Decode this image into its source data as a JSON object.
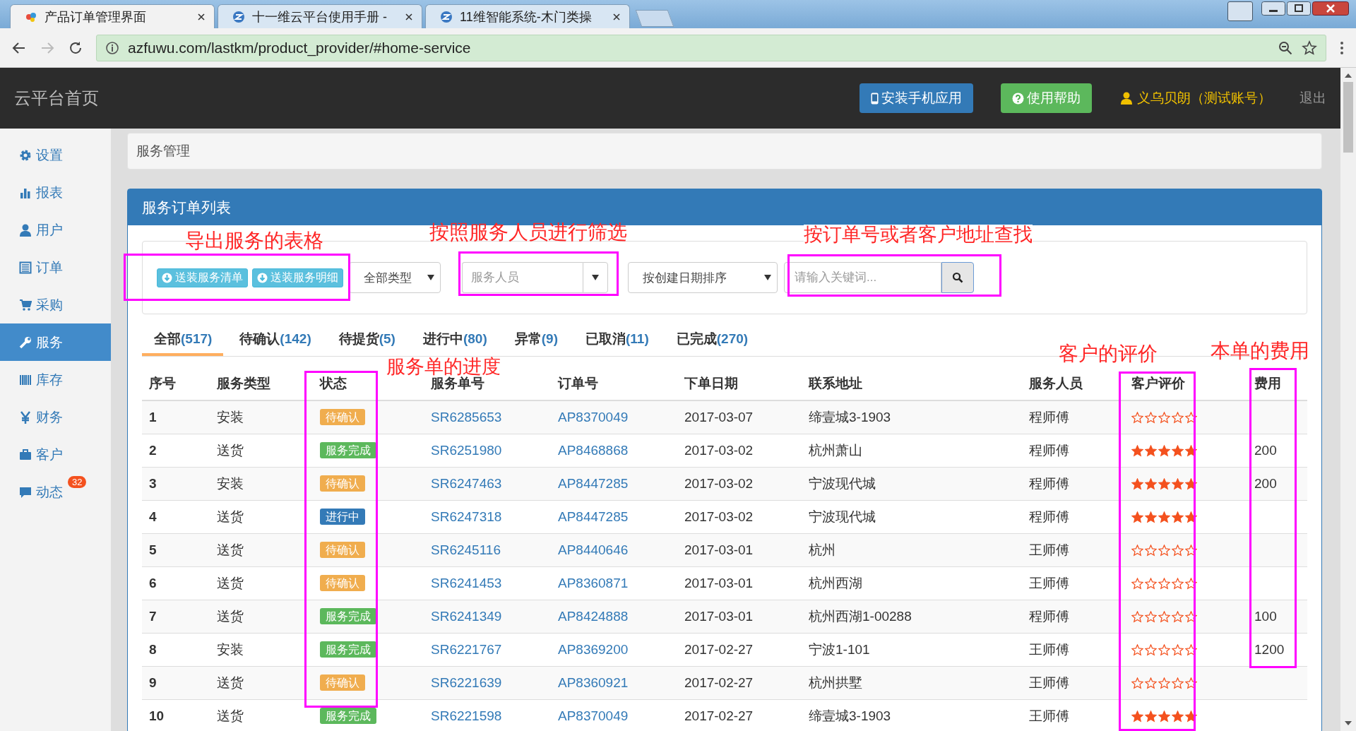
{
  "browser": {
    "tabs": [
      {
        "title": "产品订单管理界面",
        "selected": true
      },
      {
        "title": "十一维云平台使用手册 -",
        "selected": false
      },
      {
        "title": "11维智能系统-木门类操",
        "selected": false
      }
    ],
    "url": "azfuwu.com/lastkm/product_provider/#home-service"
  },
  "header": {
    "brand": "云平台首页",
    "install_button": "安装手机应用",
    "help_button": "使用帮助",
    "user": "义乌贝朗（测试账号）",
    "logout": "退出"
  },
  "sidebar": {
    "items": [
      {
        "label": "设置",
        "selected": false
      },
      {
        "label": "报表",
        "selected": false
      },
      {
        "label": "用户",
        "selected": false
      },
      {
        "label": "订单",
        "selected": false
      },
      {
        "label": "采购",
        "selected": false
      },
      {
        "label": "服务",
        "selected": true
      },
      {
        "label": "库存",
        "selected": false
      },
      {
        "label": "财务",
        "selected": false
      },
      {
        "label": "客户",
        "selected": false
      },
      {
        "label": "动态",
        "selected": false,
        "badge": "32"
      }
    ]
  },
  "breadcrumb": "服务管理",
  "panel": {
    "title": "服务订单列表",
    "export_buttons": [
      "送装服务清单",
      "送装服务明细"
    ],
    "type_select": "全部类型",
    "staff_select": {
      "placeholder": "服务人员"
    },
    "sort_select": "按创建日期排序",
    "search": {
      "placeholder": "请输入关键词..."
    },
    "tabs": [
      {
        "label": "全部",
        "count": "(517)",
        "selected": true
      },
      {
        "label": "待确认",
        "count": "(142)",
        "selected": false
      },
      {
        "label": "待提货",
        "count": "(5)",
        "selected": false
      },
      {
        "label": "进行中",
        "count": "(80)",
        "selected": false
      },
      {
        "label": "异常",
        "count": "(9)",
        "selected": false
      },
      {
        "label": "已取消",
        "count": "(11)",
        "selected": false
      },
      {
        "label": "已完成",
        "count": "(270)",
        "selected": false
      }
    ],
    "table": {
      "columns": [
        "序号",
        "服务类型",
        "状态",
        "服务单号",
        "订单号",
        "下单日期",
        "联系地址",
        "服务人员",
        "客户评价",
        "费用"
      ],
      "rows": [
        {
          "no": "1",
          "type": "安装",
          "status": {
            "text": "待确认",
            "kind": "pending"
          },
          "service_no": "SR6285653",
          "order_no": "AP8370049",
          "date": "2017-03-07",
          "address": "缔壹城3-1903",
          "staff": "程师傅",
          "stars": 0
        },
        {
          "no": "2",
          "type": "送货",
          "status": {
            "text": "服务完成",
            "kind": "done"
          },
          "service_no": "SR6251980",
          "order_no": "AP8468868",
          "date": "2017-03-02",
          "address": "杭州萧山",
          "staff": "程师傅",
          "stars": 5,
          "fee": "200"
        },
        {
          "no": "3",
          "type": "安装",
          "status": {
            "text": "待确认",
            "kind": "pending"
          },
          "service_no": "SR6247463",
          "order_no": "AP8447285",
          "date": "2017-03-02",
          "address": "宁波现代城",
          "staff": "程师傅",
          "stars": 5,
          "fee": "200"
        },
        {
          "no": "4",
          "type": "送货",
          "status": {
            "text": "进行中",
            "kind": "progress"
          },
          "service_no": "SR6247318",
          "order_no": "AP8447285",
          "date": "2017-03-02",
          "address": "宁波现代城",
          "staff": "程师傅",
          "stars": 5
        },
        {
          "no": "5",
          "type": "送货",
          "status": {
            "text": "待确认",
            "kind": "pending"
          },
          "service_no": "SR6245116",
          "order_no": "AP8440646",
          "date": "2017-03-01",
          "address": "杭州",
          "staff": "王师傅",
          "stars": 0
        },
        {
          "no": "6",
          "type": "送货",
          "status": {
            "text": "待确认",
            "kind": "pending"
          },
          "service_no": "SR6241453",
          "order_no": "AP8360871",
          "date": "2017-03-01",
          "address": "杭州西湖",
          "staff": "王师傅",
          "stars": 0
        },
        {
          "no": "7",
          "type": "送货",
          "status": {
            "text": "服务完成",
            "kind": "done"
          },
          "service_no": "SR6241349",
          "order_no": "AP8424888",
          "date": "2017-03-01",
          "address": "杭州西湖1-00288",
          "staff": "程师傅",
          "stars": 0,
          "fee": "100"
        },
        {
          "no": "8",
          "type": "安装",
          "status": {
            "text": "服务完成",
            "kind": "done"
          },
          "service_no": "SR6221767",
          "order_no": "AP8369200",
          "date": "2017-02-27",
          "address": "宁波1-101",
          "staff": "王师傅",
          "stars": 0,
          "fee": "1200"
        },
        {
          "no": "9",
          "type": "送货",
          "status": {
            "text": "待确认",
            "kind": "pending"
          },
          "service_no": "SR6221639",
          "order_no": "AP8360921",
          "date": "2017-02-27",
          "address": "杭州拱墅",
          "staff": "王师傅",
          "stars": 0
        },
        {
          "no": "10",
          "type": "送货",
          "status": {
            "text": "服务完成",
            "kind": "done"
          },
          "service_no": "SR6221598",
          "order_no": "AP8370049",
          "date": "2017-02-27",
          "address": "缔壹城3-1903",
          "staff": "王师傅",
          "stars": 5
        }
      ]
    }
  },
  "annotations": [
    {
      "text": "导出服务的表格"
    },
    {
      "text": "按照服务人员进行筛选"
    },
    {
      "text": "按订单号或者客户地址查找"
    },
    {
      "text": "服务单的进度"
    },
    {
      "text": "客户的评价"
    },
    {
      "text": "本单的费用"
    }
  ]
}
